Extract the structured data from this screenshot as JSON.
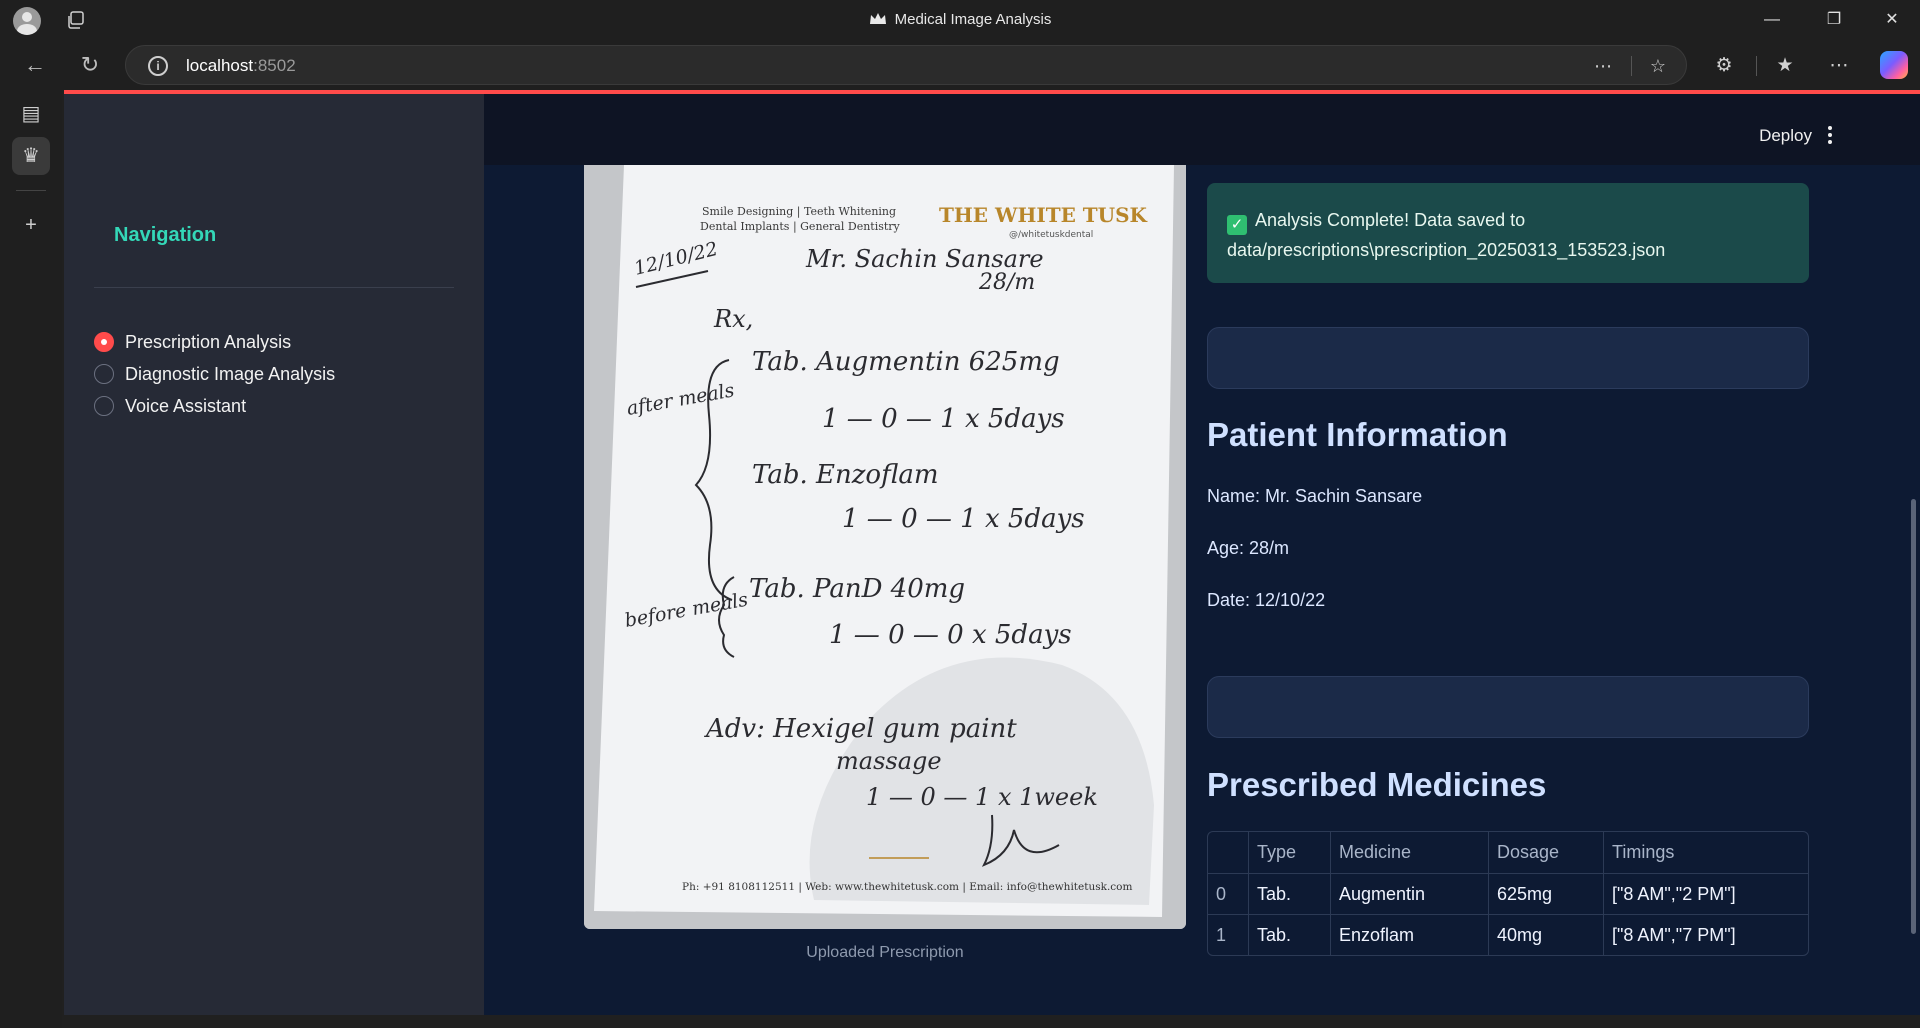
{
  "browser": {
    "window_title": "Medical Image Analysis",
    "url_host": "localhost",
    "url_port": ":8502"
  },
  "sidebar": {
    "heading": "Navigation",
    "options": [
      {
        "label": "Prescription Analysis",
        "selected": true
      },
      {
        "label": "Diagnostic Image Analysis",
        "selected": false
      },
      {
        "label": "Voice Assistant",
        "selected": false
      }
    ]
  },
  "header": {
    "deploy_label": "Deploy"
  },
  "prescription_image": {
    "clinic_tagline_1": "Smile Designing | Teeth Whitening",
    "clinic_tagline_2": "Dental Implants | General Dentistry",
    "clinic_logo": "THE WHITE TUSK",
    "clinic_handle": "@/whitetuskdental",
    "date": "12/10/22",
    "patient": "Mr. Sachin Sansare",
    "age": "28/m",
    "rx_symbol": "Rx,",
    "group_after": "after meals",
    "med1": "Tab. Augmentin 625mg",
    "med1_dose": "1 — 0 — 1  x 5days",
    "med2": "Tab. Enzoflam",
    "med2_dose": "1 — 0 — 1  x 5days",
    "group_before": "before meals",
    "med3": "Tab. PanD 40mg",
    "med3_dose": "1 — 0 — 0  x 5days",
    "advice": "Adv: Hexigel gum paint",
    "advice_2": "massage",
    "advice_dose": "1 — 0 — 1  x 1week",
    "footer": "Ph: +91 8108112511 | Web: www.thewhitetusk.com | Email: info@thewhitetusk.com",
    "caption": "Uploaded Prescription"
  },
  "status": {
    "icon": "✓",
    "message": "Analysis Complete! Data saved to data/prescriptions\\prescription_20250313_153523.json"
  },
  "patient_info": {
    "heading": "Patient Information",
    "name": "Name: Mr. Sachin Sansare",
    "age": "Age: 28/m",
    "date": "Date: 12/10/22"
  },
  "medicines": {
    "heading": "Prescribed Medicines",
    "columns": [
      "",
      "Type",
      "Medicine",
      "Dosage",
      "Timings"
    ],
    "rows": [
      [
        "0",
        "Tab.",
        "Augmentin",
        "625mg",
        "[\"8 AM\",\"2 PM\"]"
      ],
      [
        "1",
        "Tab.",
        "Enzoflam",
        "40mg",
        "[\"8 AM\",\"7 PM\"]"
      ]
    ]
  },
  "icons": {
    "browser": [
      "profile-icon",
      "tabs-icon",
      "back-icon",
      "refresh-icon",
      "info-icon",
      "reader-icon",
      "favorite-icon",
      "extensions-icon",
      "favorites-icon",
      "more-icon",
      "copilot-icon",
      "minimize-icon",
      "restore-icon",
      "close-icon"
    ],
    "vertical_bar": [
      "sidebar-toggle-icon",
      "streamlit-tab-icon",
      "new-tab-icon"
    ]
  },
  "colors": {
    "accent_red": "#ff4b4b",
    "nav_heading": "#34d8b8",
    "success_bg": "#1b4a4a",
    "page_bg": "#0d1a33",
    "sidebar_bg": "#262a36"
  }
}
